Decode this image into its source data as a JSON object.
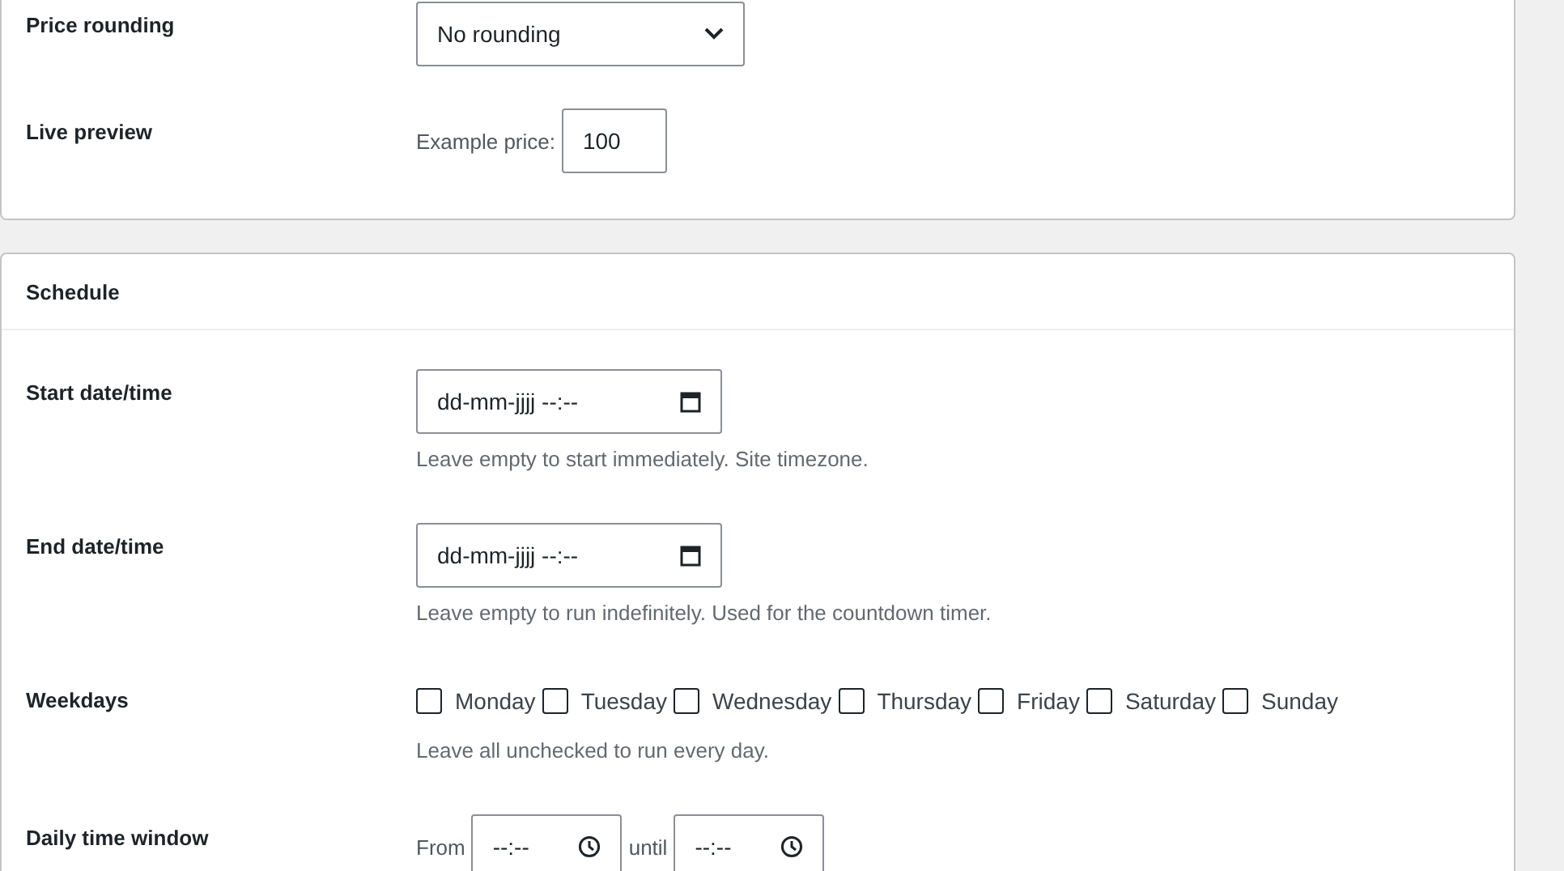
{
  "pricing": {
    "rows": [
      {
        "kind": "select",
        "label": "Price rounding",
        "value": "No rounding"
      },
      {
        "kind": "number",
        "label": "Live preview",
        "prefix": "Example price:",
        "value": "100"
      }
    ]
  },
  "schedule": {
    "title": "Schedule",
    "rows": [
      {
        "kind": "datetime",
        "label": "Start date/time",
        "placeholder": "dd-mm-jjjj --:--",
        "help": "Leave empty to start immediately. Site timezone."
      },
      {
        "kind": "datetime",
        "label": "End date/time",
        "placeholder": "dd-mm-jjjj --:--",
        "help": "Leave empty to run indefinitely. Used for the countdown timer."
      },
      {
        "kind": "weekdays",
        "label": "Weekdays",
        "days": [
          {
            "label": "Monday",
            "checked": false
          },
          {
            "label": "Tuesday",
            "checked": false
          },
          {
            "label": "Wednesday",
            "checked": false
          },
          {
            "label": "Thursday",
            "checked": false
          },
          {
            "label": "Friday",
            "checked": false
          },
          {
            "label": "Saturday",
            "checked": false
          },
          {
            "label": "Sunday",
            "checked": false
          }
        ],
        "help": "Leave all unchecked to run every day."
      },
      {
        "kind": "timewindow",
        "label": "Daily time window",
        "from_label": "From",
        "from_placeholder": "--:--",
        "until_label": "until",
        "until_placeholder": "--:--"
      }
    ]
  }
}
